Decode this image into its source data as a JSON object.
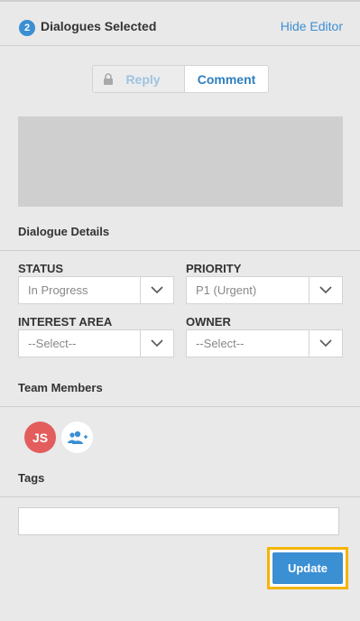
{
  "header": {
    "selected_count": "2",
    "title": "Dialogues Selected",
    "hide_editor": "Hide Editor"
  },
  "mode_toggle": {
    "reply_label": "Reply",
    "comment_label": "Comment",
    "active": "Comment",
    "reply_locked": true
  },
  "sections": {
    "dialogue_details": "Dialogue Details",
    "team_members": "Team Members",
    "tags": "Tags"
  },
  "fields": {
    "status": {
      "label": "STATUS",
      "value": "In Progress"
    },
    "priority": {
      "label": "PRIORITY",
      "value": "P1 (Urgent)"
    },
    "interest_area": {
      "label": "INTEREST AREA",
      "value": "--Select--"
    },
    "owner": {
      "label": "OWNER",
      "value": "--Select--"
    }
  },
  "team_members": [
    {
      "initials": "JS",
      "color": "#e35d5d"
    }
  ],
  "tags_input": {
    "value": ""
  },
  "actions": {
    "update_label": "Update"
  },
  "colors": {
    "accent": "#3b8fd3",
    "highlight": "#f5b400",
    "background": "#e9e9e9"
  }
}
